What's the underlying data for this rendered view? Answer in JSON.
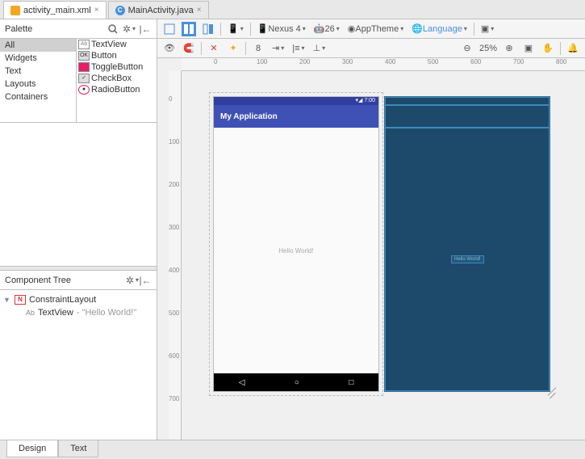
{
  "tabs": {
    "active": {
      "label": "activity_main.xml"
    },
    "inactive": {
      "label": "MainActivity.java",
      "badge": "C"
    }
  },
  "palette": {
    "title": "Palette",
    "categories": [
      "All",
      "Widgets",
      "Text",
      "Layouts",
      "Containers"
    ],
    "selected": "All",
    "items": [
      {
        "badge": "Ab",
        "label": "TextView"
      },
      {
        "badge": "OK",
        "label": "Button"
      },
      {
        "badge": "",
        "label": "ToggleButton"
      },
      {
        "badge": "",
        "label": "CheckBox"
      },
      {
        "badge": "",
        "label": "RadioButton"
      }
    ]
  },
  "componentTree": {
    "title": "Component Tree",
    "root": {
      "label": "ConstraintLayout"
    },
    "child": {
      "label": "TextView",
      "value": "\"Hello World!\""
    }
  },
  "toolbar": {
    "device": "Nexus 4",
    "api": "26",
    "theme": "AppTheme",
    "language": "Language",
    "zoom": "25%",
    "pan_number": "8"
  },
  "ruler_h": [
    "0",
    "100",
    "200",
    "300",
    "400",
    "500",
    "600",
    "700",
    "800"
  ],
  "ruler_v": [
    "0",
    "100",
    "200",
    "300",
    "400",
    "500",
    "600",
    "700"
  ],
  "device": {
    "time": "7:00",
    "title": "My Application",
    "hello": "Hello World!"
  },
  "blueprint": {
    "hello": "Hello World!"
  },
  "bottomTabs": {
    "design": "Design",
    "text": "Text"
  },
  "icons": {
    "status_signal": "▾◢",
    "nav_back": "◁",
    "nav_home": "○",
    "nav_recent": "□"
  }
}
